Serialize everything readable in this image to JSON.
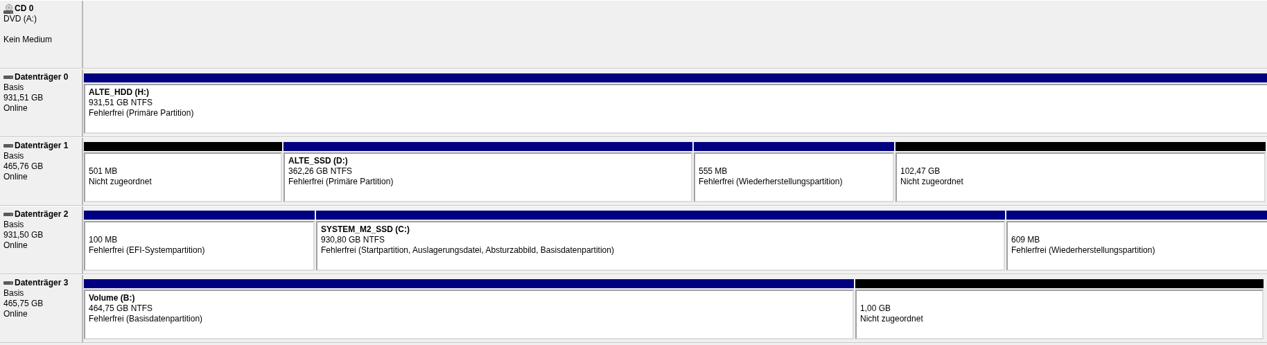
{
  "disks": [
    {
      "kind": "cdrom",
      "name": "CD 0",
      "lines": [
        "DVD (A:)",
        "Kein Medium"
      ]
    },
    {
      "kind": "disk",
      "name": "Datenträger 0",
      "lines": [
        "Basis",
        "931,51 GB",
        "Online"
      ],
      "partitions": [
        {
          "kind": "primary",
          "name": "ALTE_HDD  (H:)",
          "size": "931,51 GB NTFS",
          "status": "Fehlerfrei (Primäre Partition)"
        }
      ]
    },
    {
      "kind": "disk",
      "name": "Datenträger 1",
      "lines": [
        "Basis",
        "465,76 GB",
        "Online"
      ],
      "partitions": [
        {
          "kind": "unallocated",
          "size": "501 MB",
          "status": "Nicht zugeordnet"
        },
        {
          "kind": "primary",
          "name": "ALTE_SSD  (D:)",
          "size": "362,26 GB NTFS",
          "status": "Fehlerfrei (Primäre Partition)"
        },
        {
          "kind": "primary",
          "size": "555 MB",
          "status": "Fehlerfrei (Wiederherstellungspartition)"
        },
        {
          "kind": "unallocated",
          "size": "102,47 GB",
          "status": "Nicht zugeordnet"
        }
      ]
    },
    {
      "kind": "disk",
      "name": "Datenträger 2",
      "lines": [
        "Basis",
        "931,50 GB",
        "Online"
      ],
      "partitions": [
        {
          "kind": "primary",
          "size": "100 MB",
          "status": "Fehlerfrei (EFI-Systempartition)"
        },
        {
          "kind": "primary",
          "name": "SYSTEM_M2_SSD  (C:)",
          "size": "930,80 GB NTFS",
          "status": "Fehlerfrei (Startpartition, Auslagerungsdatei, Absturzabbild, Basisdatenpartition)"
        },
        {
          "kind": "primary",
          "size": "609 MB",
          "status": "Fehlerfrei (Wiederherstellungspartition)"
        }
      ]
    },
    {
      "kind": "disk",
      "name": "Datenträger 3",
      "lines": [
        "Basis",
        "465,75 GB",
        "Online"
      ],
      "partitions": [
        {
          "kind": "primary",
          "name": "Volume  (B:)",
          "size": "464,75 GB NTFS",
          "status": "Fehlerfrei (Basisdatenpartition)"
        },
        {
          "kind": "unallocated",
          "size": "1,00 GB",
          "status": "Nicht zugeordnet"
        }
      ]
    }
  ]
}
